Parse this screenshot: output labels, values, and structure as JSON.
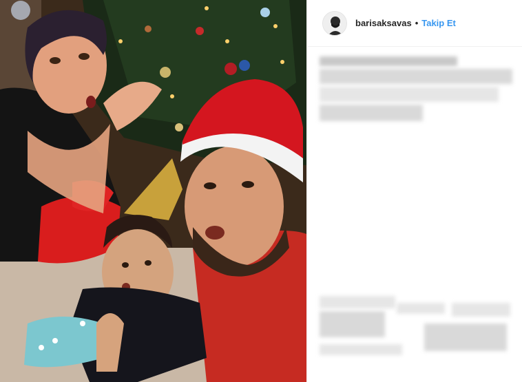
{
  "post": {
    "username": "barisaksavas",
    "separator": "•",
    "follow_label": "Takip Et"
  },
  "icons": {
    "avatar": "profile-avatar-icon"
  },
  "colors": {
    "follow_blue": "#3897f0",
    "username_text": "#262626",
    "blur_gray": "#d9d9d9"
  }
}
